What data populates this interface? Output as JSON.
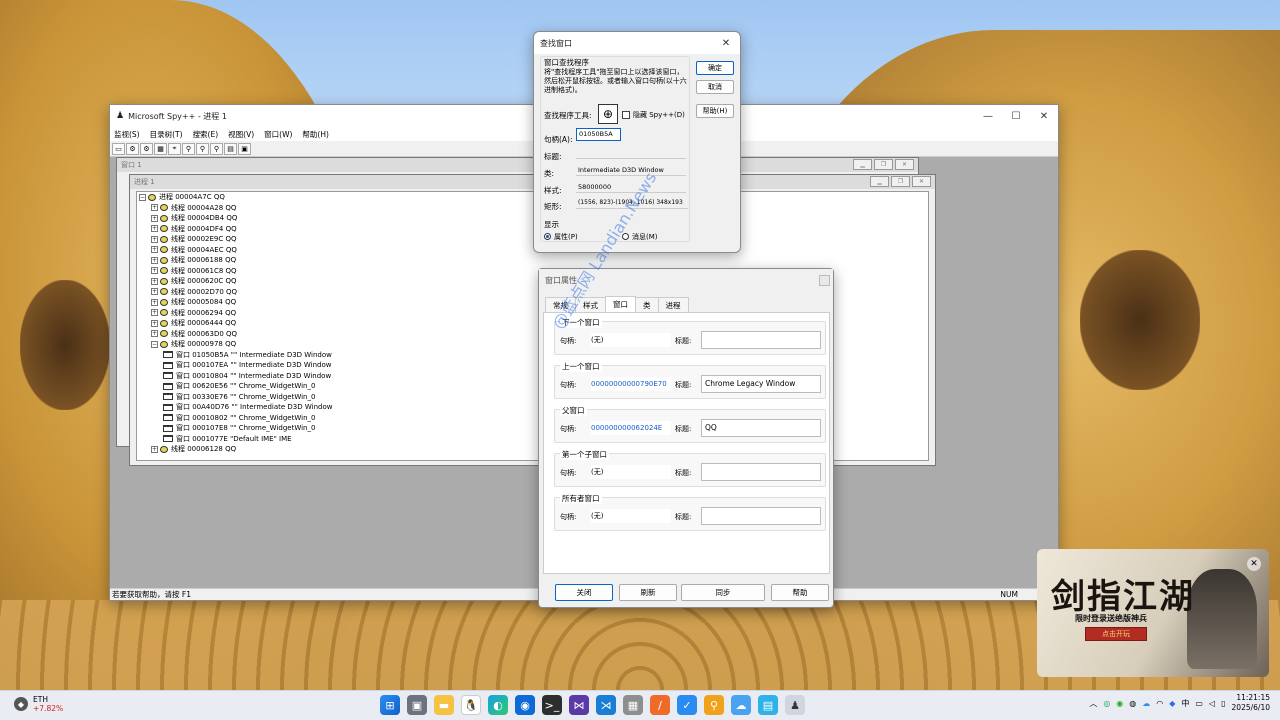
{
  "spy": {
    "title": "Microsoft Spy++ - 进程 1",
    "menu": [
      "监视(S)",
      "目录树(T)",
      "搜索(E)",
      "视图(V)",
      "窗口(W)",
      "帮助(H)"
    ],
    "status": "若要获取帮助，请按 F1",
    "num": "NUM",
    "mdi_back_title": "窗口 1",
    "mdi_front_title": "进程 1",
    "tree": [
      {
        "kind": "proc",
        "indent": 0,
        "text": "进程 00004A7C QQ"
      },
      {
        "kind": "thread",
        "indent": 1,
        "text": "线程 00004A28 QQ"
      },
      {
        "kind": "thread",
        "indent": 1,
        "text": "线程 00004DB4 QQ"
      },
      {
        "kind": "thread",
        "indent": 1,
        "text": "线程 00004DF4 QQ"
      },
      {
        "kind": "thread",
        "indent": 1,
        "text": "线程 00002E9C QQ"
      },
      {
        "kind": "thread",
        "indent": 1,
        "text": "线程 00004AEC QQ"
      },
      {
        "kind": "thread",
        "indent": 1,
        "text": "线程 00006188 QQ"
      },
      {
        "kind": "thread",
        "indent": 1,
        "text": "线程 000061C8 QQ"
      },
      {
        "kind": "thread",
        "indent": 1,
        "text": "线程 0000620C QQ"
      },
      {
        "kind": "thread",
        "indent": 1,
        "text": "线程 00002D70 QQ"
      },
      {
        "kind": "thread",
        "indent": 1,
        "text": "线程 00005084 QQ"
      },
      {
        "kind": "thread",
        "indent": 1,
        "text": "线程 00006294 QQ"
      },
      {
        "kind": "thread",
        "indent": 1,
        "text": "线程 00006444 QQ"
      },
      {
        "kind": "thread",
        "indent": 1,
        "text": "线程 000063D0 QQ"
      },
      {
        "kind": "thread-open",
        "indent": 1,
        "text": "线程 00000978 QQ"
      },
      {
        "kind": "win",
        "indent": 2,
        "text": "窗口 01050B5A \"\" Intermediate D3D Window"
      },
      {
        "kind": "win",
        "indent": 2,
        "text": "窗口 000107EA \"\" Intermediate D3D Window"
      },
      {
        "kind": "win",
        "indent": 2,
        "text": "窗口 00010804 \"\" Intermediate D3D Window"
      },
      {
        "kind": "win",
        "indent": 2,
        "text": "窗口 00620E56 \"\" Chrome_WidgetWin_0"
      },
      {
        "kind": "win",
        "indent": 2,
        "text": "窗口 00330E76 \"\" Chrome_WidgetWin_0"
      },
      {
        "kind": "win",
        "indent": 2,
        "text": "窗口 00A40D76 \"\" Intermediate D3D Window"
      },
      {
        "kind": "win",
        "indent": 2,
        "text": "窗口 00010802 \"\" Chrome_WidgetWin_0"
      },
      {
        "kind": "win",
        "indent": 2,
        "text": "窗口 000107E8 \"\" Chrome_WidgetWin_0"
      },
      {
        "kind": "win",
        "indent": 2,
        "text": "窗口 0001077E \"Default IME\" IME"
      },
      {
        "kind": "thread",
        "indent": 1,
        "text": "线程 00006128 QQ"
      }
    ]
  },
  "find": {
    "title": "查找窗口",
    "group_title": "窗口查找程序",
    "desc": "将\"查找程序工具\"拖至窗口上以选择该窗口，然后松开鼠标按钮。或者输入窗口句柄(以十六进制格式)。",
    "tool_label": "查找程序工具:",
    "hide_label": "隐藏 Spy++(D)",
    "handle_label": "句柄(A):",
    "handle_value": "01050B5A",
    "caption_label": "标题:",
    "caption_value": "",
    "class_label": "类:",
    "class_value": "Intermediate D3D Window",
    "style_label": "样式:",
    "style_value": "58000000",
    "rect_label": "矩形:",
    "rect_value": "(1556, 823)-(1904, 1016) 348x193",
    "show_label": "显示",
    "radio_props": "属性(P)",
    "radio_msgs": "消息(M)",
    "ok": "确定",
    "cancel": "取消",
    "help": "帮助(H)"
  },
  "props": {
    "title": "窗口属性",
    "tabs": [
      "常规",
      "样式",
      "窗口",
      "类",
      "进程"
    ],
    "active_tab": "窗口",
    "groups": [
      {
        "title": "下一个窗口",
        "handle_label": "句柄:",
        "handle": "(无)",
        "caption_label": "标题:",
        "caption": "",
        "link": false
      },
      {
        "title": "上一个窗口",
        "handle_label": "句柄:",
        "handle": "00000000000790E70",
        "caption_label": "标题:",
        "caption": "Chrome Legacy Window",
        "link": true
      },
      {
        "title": "父窗口",
        "handle_label": "句柄:",
        "handle": "000000000062024E",
        "caption_label": "标题:",
        "caption": "QQ",
        "link": true
      },
      {
        "title": "第一个子窗口",
        "handle_label": "句柄:",
        "handle": "(无)",
        "caption_label": "标题:",
        "caption": "",
        "link": false
      },
      {
        "title": "所有者窗口",
        "handle_label": "句柄:",
        "handle": "(无)",
        "caption_label": "标题:",
        "caption": "",
        "link": false
      }
    ],
    "btn_close": "关闭",
    "btn_refresh": "刷新",
    "btn_sync": "同步",
    "btn_help": "帮助"
  },
  "watermark": "@蓝点网 Landian.News",
  "ad": {
    "title": "剑指江湖",
    "subtitle": "限时登录送绝版神兵",
    "button": "点击开玩"
  },
  "taskbar": {
    "ticker_name": "ETH",
    "ticker_change": "+7.82%",
    "tray_lang": "中",
    "time": "11:21:15",
    "date": "2025/6/10"
  }
}
